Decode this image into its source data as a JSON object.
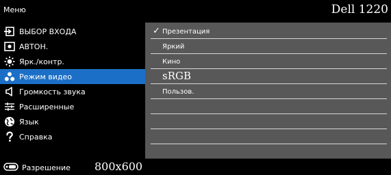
{
  "header": {
    "menu_title": "Меню",
    "model": "Dell 1220"
  },
  "sidebar": {
    "items": [
      {
        "label": "ВЫБОР ВХОДА",
        "icon": "input-source-icon"
      },
      {
        "label": "АВТОН.",
        "icon": "auto-adjust-icon"
      },
      {
        "label": "Ярк./контр.",
        "icon": "brightness-icon"
      },
      {
        "label": "Режим видео",
        "icon": "video-mode-icon",
        "active": true
      },
      {
        "label": "Громкость звука",
        "icon": "volume-icon"
      },
      {
        "label": "Расширенные",
        "icon": "advanced-settings-icon"
      },
      {
        "label": "Язык",
        "icon": "language-icon"
      },
      {
        "label": "Справка",
        "icon": "help-icon"
      }
    ]
  },
  "panel": {
    "options": [
      {
        "label": "Презентация",
        "selected": true
      },
      {
        "label": "Яркий"
      },
      {
        "label": "Кино"
      },
      {
        "label": "sRGB"
      },
      {
        "label": "Пользов."
      }
    ],
    "check_mark": "✓"
  },
  "footer": {
    "resolution_label": "Разрешение",
    "resolution_value": "800x600",
    "icon": "projector-icon"
  },
  "colors": {
    "accent": "#1c6fc6",
    "panel": "#585858",
    "background": "#000000",
    "text": "#ffffff"
  }
}
